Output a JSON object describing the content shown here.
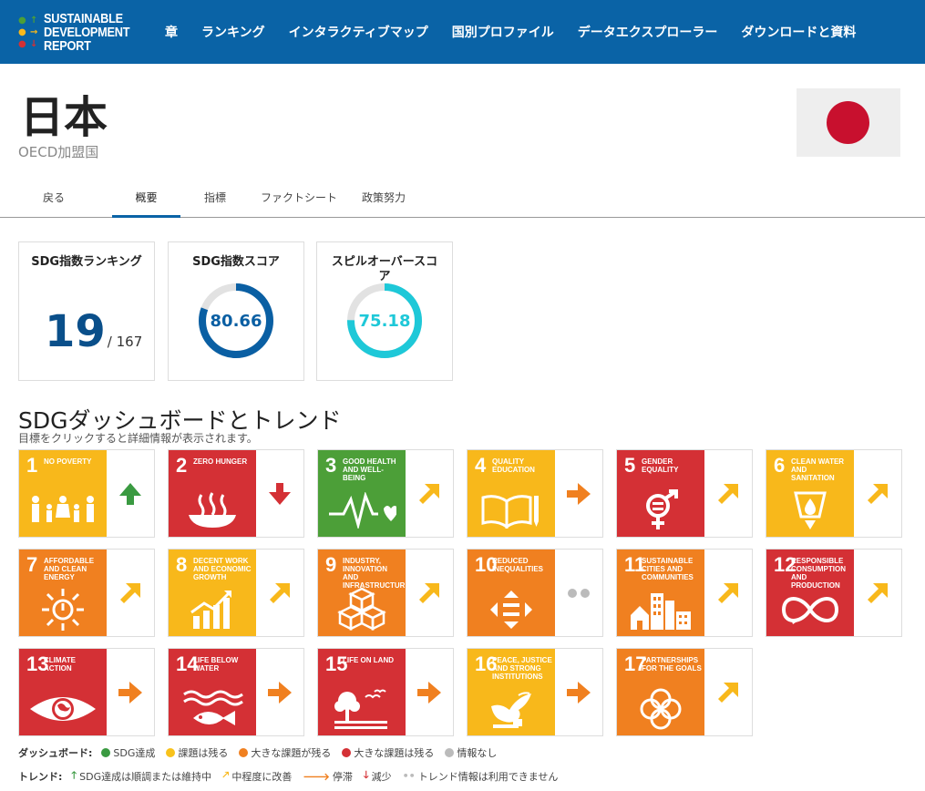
{
  "header": {
    "logo_lines": [
      "SUSTAINABLE",
      "DEVELOPMENT",
      "REPORT"
    ],
    "nav": [
      "章",
      "ランキング",
      "インタラクティブマップ",
      "国別プロファイル",
      "データエクスプローラー",
      "ダウンロードと資料"
    ]
  },
  "country": {
    "name": "日本",
    "subtitle": "OECD加盟国"
  },
  "tabs": [
    "戻る",
    "概要",
    "指標",
    "ファクトシート",
    "政策努力"
  ],
  "cards": {
    "ranking": {
      "title": "SDG指数ランキング",
      "rank": "19",
      "total": "/ 167"
    },
    "score": {
      "title": "SDG指数スコア",
      "value": "80.66",
      "percent": 80.66,
      "color": "#0a5fa3"
    },
    "spillover": {
      "title": "スピルオーバースコア",
      "value": "75.18",
      "percent": 75.18,
      "color": "#1ec8d8"
    }
  },
  "dashboard": {
    "title": "SDGダッシュボードとトレンド",
    "subtitle": "目標をクリックすると詳細情報が表示されます。",
    "goals": [
      {
        "num": "1",
        "text": "NO POVERTY",
        "color": "#f8b81b",
        "icon": "family-icon",
        "trend": "up",
        "trend_color": "#3a9a41"
      },
      {
        "num": "2",
        "text": "ZERO HUNGER",
        "color": "#d43035",
        "icon": "bowl-icon",
        "trend": "down",
        "trend_color": "#d43035"
      },
      {
        "num": "3",
        "text": "GOOD HEALTH AND WELL-BEING",
        "color": "#4c9f38",
        "icon": "heartbeat-icon",
        "trend": "moderate",
        "trend_color": "#f8b81b"
      },
      {
        "num": "4",
        "text": "QUALITY EDUCATION",
        "color": "#f8b81b",
        "icon": "book-icon",
        "trend": "stagnate",
        "trend_color": "#f08020"
      },
      {
        "num": "5",
        "text": "GENDER EQUALITY",
        "color": "#d43035",
        "icon": "gender-icon",
        "trend": "moderate",
        "trend_color": "#f8b81b"
      },
      {
        "num": "6",
        "text": "CLEAN WATER AND SANITATION",
        "color": "#f8b81b",
        "icon": "water-icon",
        "trend": "moderate",
        "trend_color": "#f8b81b"
      },
      {
        "num": "7",
        "text": "AFFORDABLE AND CLEAN ENERGY",
        "color": "#f08020",
        "icon": "sun-icon",
        "trend": "moderate",
        "trend_color": "#f8b81b"
      },
      {
        "num": "8",
        "text": "DECENT WORK AND ECONOMIC GROWTH",
        "color": "#f8b81b",
        "icon": "growth-chart-icon",
        "trend": "moderate",
        "trend_color": "#f8b81b"
      },
      {
        "num": "9",
        "text": "INDUSTRY, INNOVATION AND INFRASTRUCTURE",
        "color": "#f08020",
        "icon": "cubes-icon",
        "trend": "moderate",
        "trend_color": "#f8b81b"
      },
      {
        "num": "10",
        "text": "REDUCED INEQUALITIES",
        "color": "#f08020",
        "icon": "equality-icon",
        "trend": "na",
        "trend_color": "#bbbbbb"
      },
      {
        "num": "11",
        "text": "SUSTAINABLE CITIES AND COMMUNITIES",
        "color": "#f08020",
        "icon": "city-icon",
        "trend": "moderate",
        "trend_color": "#f8b81b"
      },
      {
        "num": "12",
        "text": "RESPONSIBLE CONSUMPTION AND PRODUCTION",
        "color": "#d43035",
        "icon": "infinity-icon",
        "trend": "moderate",
        "trend_color": "#f8b81b"
      },
      {
        "num": "13",
        "text": "CLIMATE ACTION",
        "color": "#d43035",
        "icon": "eye-globe-icon",
        "trend": "stagnate",
        "trend_color": "#f08020"
      },
      {
        "num": "14",
        "text": "LIFE BELOW WATER",
        "color": "#d43035",
        "icon": "fish-icon",
        "trend": "stagnate",
        "trend_color": "#f08020"
      },
      {
        "num": "15",
        "text": "LIFE ON LAND",
        "color": "#d43035",
        "icon": "tree-icon",
        "trend": "stagnate",
        "trend_color": "#f08020"
      },
      {
        "num": "16",
        "text": "PEACE, JUSTICE AND STRONG INSTITUTIONS",
        "color": "#f8b81b",
        "icon": "dove-icon",
        "trend": "stagnate",
        "trend_color": "#f08020"
      },
      {
        "num": "17",
        "text": "PARTNERSHIPS FOR THE GOALS",
        "color": "#f08020",
        "icon": "rings-icon",
        "trend": "moderate",
        "trend_color": "#f8b81b"
      }
    ]
  },
  "legend": {
    "dashboard_label": "ダッシュボード:",
    "dashboard_items": [
      {
        "label": "SDG達成",
        "color": "#3a9a41"
      },
      {
        "label": "課題は残る",
        "color": "#f8c21b"
      },
      {
        "label": "大きな課題が残る",
        "color": "#f08020"
      },
      {
        "label": "大きな課題は残る",
        "color": "#d43035"
      },
      {
        "label": "情報なし",
        "color": "#bbbbbb"
      }
    ],
    "trend_label": "トレンド:",
    "trend_items": [
      {
        "symbol": "🡑",
        "label": "SDG達成は順調または維持中",
        "color": "#3a9a41"
      },
      {
        "symbol": "🡕",
        "label": "中程度に改善",
        "color": "#f8b81b"
      },
      {
        "symbol": "🡒",
        "label": "停滞",
        "color": "#f08020"
      },
      {
        "symbol": "🡓",
        "label": "減少",
        "color": "#d43035"
      },
      {
        "symbol": "••",
        "label": "トレンド情報は利用できません",
        "color": "#bbbbbb"
      }
    ]
  }
}
